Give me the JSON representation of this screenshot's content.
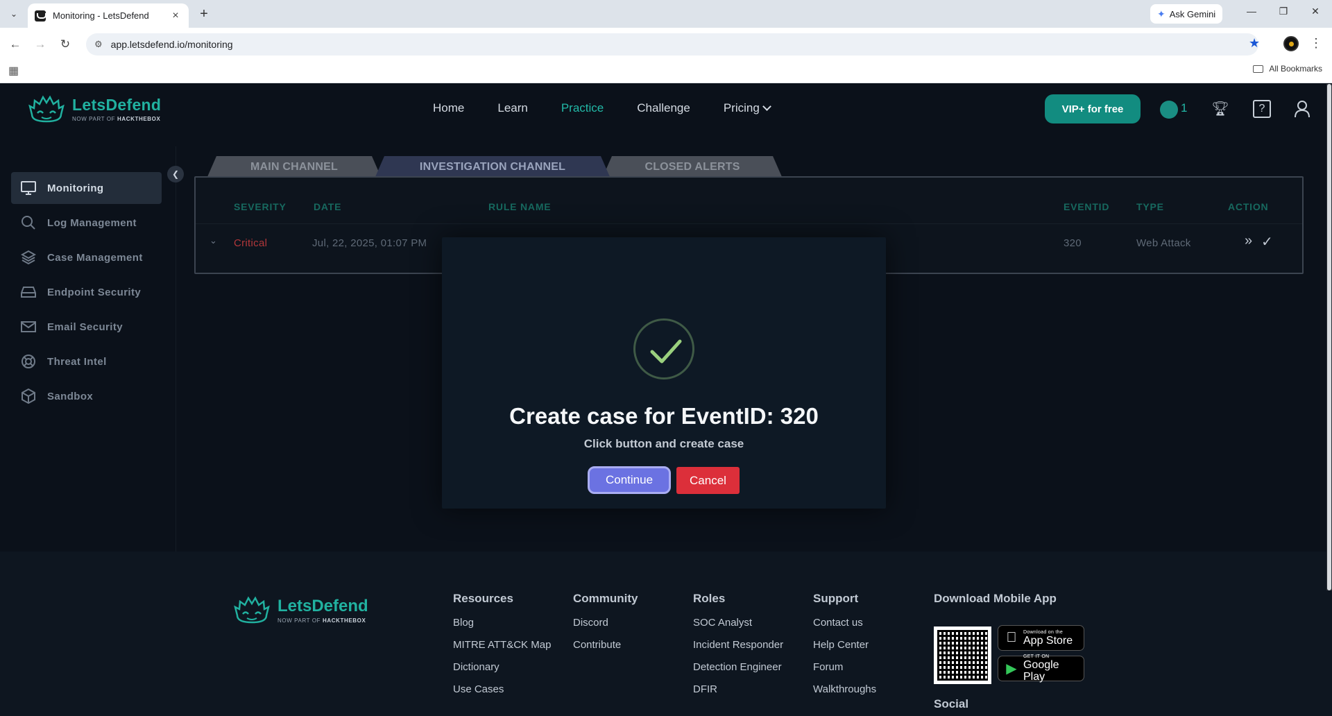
{
  "browser": {
    "tab_title": "Monitoring - LetsDefend",
    "url": "app.letsdefend.io/monitoring",
    "gemini_label": "Ask Gemini",
    "bookmarks_label": "All Bookmarks"
  },
  "header": {
    "brand": "LetsDefend",
    "brand_sub_prefix": "NOW PART OF",
    "brand_sub_name": "HACKTHEBOX",
    "nav": [
      "Home",
      "Learn",
      "Practice",
      "Challenge",
      "Pricing"
    ],
    "active_nav": "Practice",
    "vip_label": "VIP+ for free",
    "globe_count": "1"
  },
  "sidebar": {
    "items": [
      {
        "label": "Monitoring",
        "icon": "monitor-icon",
        "active": true
      },
      {
        "label": "Log Management",
        "icon": "search-icon",
        "active": false
      },
      {
        "label": "Case Management",
        "icon": "layers-icon",
        "active": false
      },
      {
        "label": "Endpoint Security",
        "icon": "hard-drive-icon",
        "active": false
      },
      {
        "label": "Email Security",
        "icon": "mail-icon",
        "active": false
      },
      {
        "label": "Threat Intel",
        "icon": "lifebuoy-icon",
        "active": false
      },
      {
        "label": "Sandbox",
        "icon": "box-icon",
        "active": false
      }
    ]
  },
  "channels": {
    "main": "MAIN CHANNEL",
    "investigation": "INVESTIGATION CHANNEL",
    "closed": "CLOSED ALERTS"
  },
  "table": {
    "headers": {
      "severity": "SEVERITY",
      "date": "DATE",
      "rule_name": "RULE NAME",
      "eventid": "EVENTID",
      "type": "TYPE",
      "action": "ACTION"
    },
    "rows": [
      {
        "severity": "Critical",
        "date": "Jul, 22, 2025, 01:07 PM",
        "rule_name": "",
        "eventid": "320",
        "type": "Web Attack"
      }
    ]
  },
  "modal": {
    "title": "Create case for EventID: 320",
    "subtitle": "Click button and create case",
    "continue_label": "Continue",
    "cancel_label": "Cancel"
  },
  "footer": {
    "brand": "LetsDefend",
    "brand_sub_prefix": "NOW PART OF",
    "brand_sub_name": "HACKTHEBOX",
    "columns": [
      {
        "heading": "Resources",
        "links": [
          "Blog",
          "MITRE ATT&CK Map",
          "Dictionary",
          "Use Cases"
        ]
      },
      {
        "heading": "Community",
        "links": [
          "Discord",
          "Contribute"
        ]
      },
      {
        "heading": "Roles",
        "links": [
          "SOC Analyst",
          "Incident Responder",
          "Detection Engineer",
          "DFIR"
        ]
      },
      {
        "heading": "Support",
        "links": [
          "Contact us",
          "Help Center",
          "Forum",
          "Walkthroughs"
        ]
      }
    ],
    "download_heading": "Download Mobile App",
    "app_store": {
      "small": "Download on the",
      "big": "App Store"
    },
    "google_play": {
      "small": "GET IT ON",
      "big": "Google Play"
    },
    "social_heading": "Social"
  },
  "colors": {
    "accent": "#22b9a7",
    "critical": "#b2373a",
    "continue": "#6b72e2",
    "cancel": "#dc2f3a"
  }
}
